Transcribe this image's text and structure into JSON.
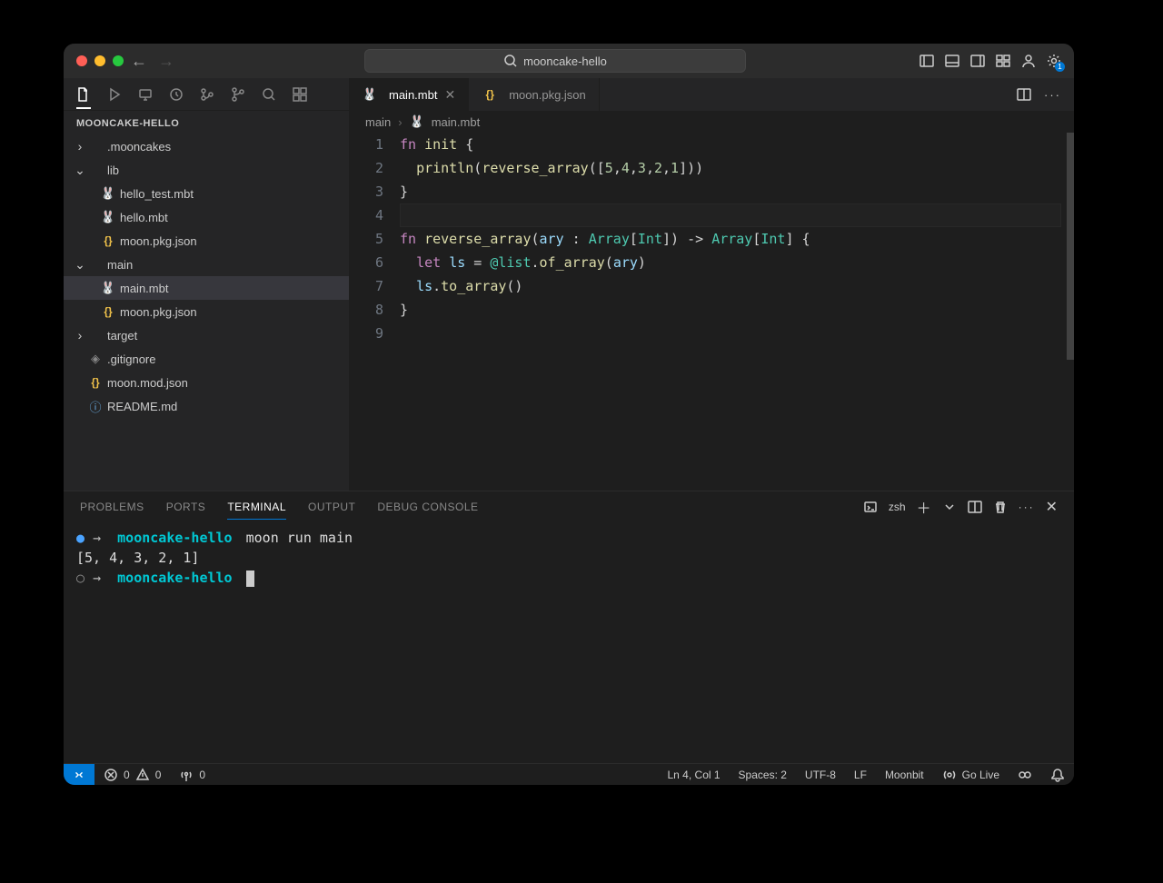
{
  "title": "mooncake-hello",
  "explorer_title": "MOONCAKE-HELLO",
  "settings_badge": "1",
  "tree": [
    {
      "indent": 0,
      "chev": "right",
      "icon": "",
      "label": ".mooncakes"
    },
    {
      "indent": 0,
      "chev": "down",
      "icon": "",
      "label": "lib"
    },
    {
      "indent": 1,
      "chev": "none",
      "icon": "rabbit",
      "label": "hello_test.mbt"
    },
    {
      "indent": 1,
      "chev": "none",
      "icon": "rabbit",
      "label": "hello.mbt"
    },
    {
      "indent": 1,
      "chev": "none",
      "icon": "json",
      "label": "moon.pkg.json"
    },
    {
      "indent": 0,
      "chev": "down",
      "icon": "",
      "label": "main"
    },
    {
      "indent": 1,
      "chev": "none",
      "icon": "rabbit",
      "label": "main.mbt",
      "selected": true
    },
    {
      "indent": 1,
      "chev": "none",
      "icon": "json",
      "label": "moon.pkg.json"
    },
    {
      "indent": 0,
      "chev": "right",
      "icon": "",
      "label": "target"
    },
    {
      "indent": 0,
      "chev": "none",
      "icon": "diamond",
      "label": ".gitignore"
    },
    {
      "indent": 0,
      "chev": "none",
      "icon": "json",
      "label": "moon.mod.json"
    },
    {
      "indent": 0,
      "chev": "none",
      "icon": "info",
      "label": "README.md"
    }
  ],
  "tabs": [
    {
      "icon": "rabbit",
      "label": "main.mbt",
      "active": true,
      "close": true
    },
    {
      "icon": "json",
      "label": "moon.pkg.json",
      "active": false,
      "close": false
    }
  ],
  "breadcrumb": {
    "folder": "main",
    "file": "main.mbt"
  },
  "code_lines": [
    "fn init {",
    "  println(reverse_array([5,4,3,2,1]))",
    "}",
    "",
    "fn reverse_array(ary : Array[Int]) -> Array[Int] {",
    "  let ls = @list.of_array(ary)",
    "  ls.to_array()",
    "}",
    ""
  ],
  "cursor_line": 4,
  "panel_tabs": [
    "PROBLEMS",
    "PORTS",
    "TERMINAL",
    "OUTPUT",
    "DEBUG CONSOLE"
  ],
  "panel_active": "TERMINAL",
  "terminal_shell": "zsh",
  "terminal": {
    "line1_prefix": "●",
    "line1_arrow": "→",
    "line1_cwd": "mooncake-hello",
    "line1_cmd": "moon run main",
    "line2_output": "[5, 4, 3, 2, 1]",
    "line3_prefix": "○",
    "line3_arrow": "→",
    "line3_cwd": "mooncake-hello"
  },
  "status": {
    "errors": "0",
    "warnings": "0",
    "ports": "0",
    "cursor": "Ln 4, Col 1",
    "spaces": "Spaces: 2",
    "encoding": "UTF-8",
    "eol": "LF",
    "lang": "Moonbit",
    "golive": "Go Live"
  }
}
